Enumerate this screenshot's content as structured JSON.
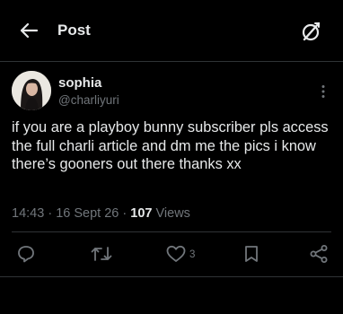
{
  "header": {
    "title": "Post",
    "back_icon": "arrow-left-icon",
    "grok_icon": "grok-icon"
  },
  "post": {
    "author_name": "sophia",
    "author_handle": "@charliyuri",
    "text": "if you are a playboy bunny subscriber pls access the full charli article and dm me the pics i know there’s gooners out there thanks xx",
    "time": "14:43",
    "separator": "·",
    "date": "16 Sept 26",
    "views_count": "107",
    "views_label": "Views"
  },
  "actions": {
    "reply_icon": "reply-icon",
    "repost_icon": "repost-icon",
    "like_icon": "heart-icon",
    "like_count": "3",
    "bookmark_icon": "bookmark-icon",
    "share_icon": "share-icon"
  },
  "colors": {
    "background": "#000000",
    "text_primary": "#e7e9ea",
    "text_secondary": "#71767b",
    "divider": "#2f3336"
  }
}
